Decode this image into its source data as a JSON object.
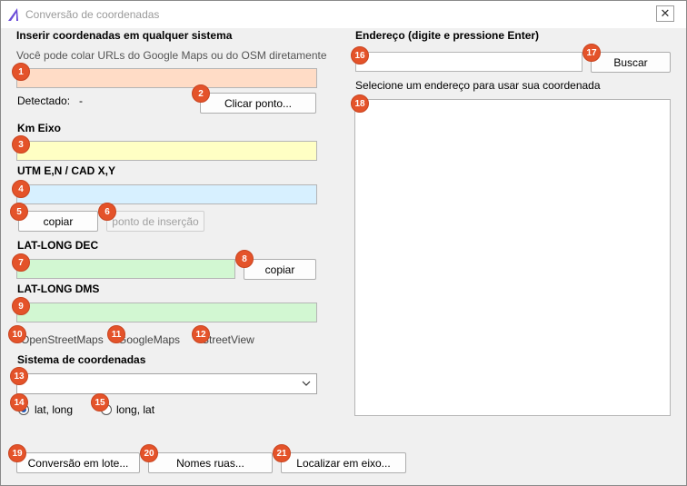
{
  "window": {
    "title": "Conversão de coordenadas",
    "close_glyph": "✕"
  },
  "left": {
    "header": "Inserir coordenadas em qualquer sistema",
    "hint": "Você pode colar URLs do Google Maps ou do OSM diretamente",
    "coord_input": {
      "value": "",
      "color": "#ffdcc6"
    },
    "detected_label": "Detectado:",
    "detected_value": "-",
    "click_point_button": "Clicar ponto...",
    "km_label": "Km Eixo",
    "km_input": {
      "value": "",
      "color": "#ffffc4"
    },
    "utm_label": "UTM E,N / CAD X,Y",
    "utm_input": {
      "value": "",
      "color": "#d7f0ff"
    },
    "copy_utm_button": "copiar",
    "insertion_point_button": "ponto de inserção",
    "latlong_dec_label": "LAT-LONG DEC",
    "latlong_dec_input": {
      "value": "",
      "color": "#d2f7d2"
    },
    "copy_dec_button": "copiar",
    "latlong_dms_label": "LAT-LONG DMS",
    "latlong_dms_input": {
      "value": "",
      "color": "#d2f7d2"
    },
    "links": [
      "OpenStreetMaps",
      "GoogleMaps",
      "StreetView"
    ],
    "system_label": "Sistema de coordenadas",
    "system_select": {
      "value": ""
    },
    "radios": [
      {
        "label": "lat, long",
        "checked": true
      },
      {
        "label": "long, lat",
        "checked": false
      }
    ]
  },
  "right": {
    "header": "Endereço (digite e pressione Enter)",
    "address_input": {
      "value": "",
      "placeholder": ""
    },
    "search_button": "Buscar",
    "select_hint": "Selecione um endereço para usar sua coordenada",
    "results": []
  },
  "bottom": {
    "batch_button": "Conversão em lote...",
    "street_names_button": "Nomes ruas...",
    "locate_axis_button": "Localizar em eixo..."
  },
  "badges": [
    "1",
    "2",
    "3",
    "4",
    "5",
    "6",
    "7",
    "8",
    "9",
    "10",
    "11",
    "12",
    "13",
    "14",
    "15",
    "16",
    "17",
    "18",
    "19",
    "20",
    "21"
  ],
  "colors": {
    "badge": "#e4532a",
    "radio_checked": "#1e5bb8",
    "app_icon": "#6a4bd8"
  }
}
